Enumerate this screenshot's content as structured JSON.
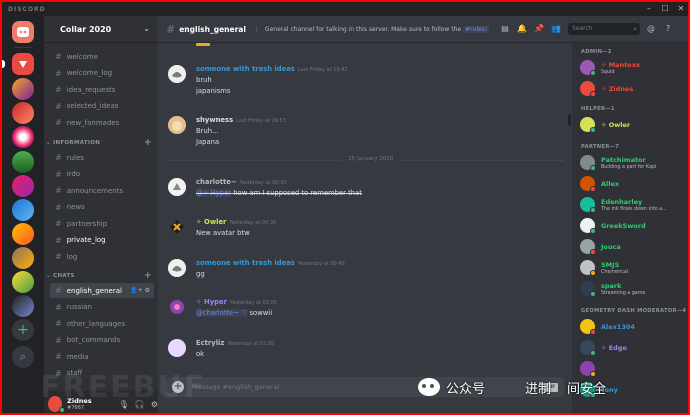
{
  "app": {
    "brand": "DISCORD",
    "window_controls": {
      "minimize": "–",
      "maximize": "☐",
      "close": "✕"
    }
  },
  "server": {
    "name": "Collar 2020"
  },
  "channels": {
    "top": [
      "welcome",
      "welcome_log",
      "idea_requests",
      "selected_ideas",
      "new_fanmades"
    ],
    "information_label": "INFORMATION",
    "information": [
      "rules",
      "irdo",
      "announcements",
      "news",
      "partnership",
      "private_log",
      "log"
    ],
    "chats_label": "CHATS",
    "chats": [
      "english_general",
      "russian",
      "other_languages",
      "bot_commands",
      "media",
      "staff"
    ]
  },
  "user": {
    "name": "Zidnes",
    "tag": "#7667"
  },
  "header": {
    "channel": "english_general",
    "topic": "General channel for talking in this server. Make sure to follow the",
    "topic_tag": "#rules!",
    "search_placeholder": "Search"
  },
  "messages": [
    {
      "author": "someone with trash ideas",
      "color": "#3498db",
      "time": "Last Friday at 19:42",
      "lines": [
        "bruh",
        "japanisms"
      ]
    },
    {
      "author": "shywness",
      "color": "#dcddde",
      "time": "Last Friday at 19:53",
      "lines": [
        "Bruh...",
        "Japana"
      ]
    },
    {
      "author": "charlotte~",
      "color": "#b9bbbe",
      "time": "Yesterday at 00:30",
      "mention": "@✧ Hyper",
      "text": "how am I supposed to remember that"
    },
    {
      "author": "✧ Owler",
      "color": "#d4e157",
      "time": "Yesterday at 00:30",
      "lines": [
        "New avatar btw"
      ]
    },
    {
      "author": "someone with trash ideas",
      "color": "#3498db",
      "time": "Yesterday at 00:49",
      "lines": [
        "gg"
      ]
    },
    {
      "author": "✧ Hyper",
      "color": "#9b84ee",
      "time": "Yesterday at 02:05",
      "mention": "@charlotte~ ♡",
      "text": "sowwii"
    },
    {
      "author": "Ectryliz",
      "color": "#b9bbbe",
      "time": "Yesterday at 02:05",
      "lines": [
        "ok"
      ]
    }
  ],
  "date_divider": "25 January 2020",
  "composer": {
    "placeholder": "Message #english_general",
    "gift": "GIF"
  },
  "members": {
    "groups": [
      {
        "label": "ADMIN—2",
        "items": [
          {
            "name": "✧ Mantexx",
            "sub": "Squid",
            "color": "#e74c3c"
          },
          {
            "name": "✧ Zidnes",
            "sub": "",
            "color": "#e74c3c"
          }
        ]
      },
      {
        "label": "HELPER—1",
        "items": [
          {
            "name": "✧ Owler",
            "sub": "",
            "color": "#d4e157"
          }
        ]
      },
      {
        "label": "PARTNER—7",
        "items": [
          {
            "name": "Patchimator",
            "sub": "Building a part for Kapi",
            "color": "#2ecc71"
          },
          {
            "name": "Allex",
            "sub": "",
            "color": "#2ecc71"
          },
          {
            "name": "Edenharley",
            "sub": "The ink flows down into a...",
            "color": "#2ecc71"
          },
          {
            "name": "GreekSword",
            "sub": "",
            "color": "#2ecc71"
          },
          {
            "name": "Jouca",
            "sub": "",
            "color": "#2ecc71"
          },
          {
            "name": "SMJS",
            "sub": "Chemerical",
            "color": "#2ecc71"
          },
          {
            "name": "spark",
            "sub": "Streaming a game",
            "color": "#2ecc71"
          }
        ]
      },
      {
        "label": "GEOMETRY DASH MODERATOR—4",
        "items": [
          {
            "name": "Alex1304",
            "sub": "",
            "color": "#3498db"
          },
          {
            "name": "✧ Edge",
            "sub": "",
            "color": "#9b84ee"
          },
          {
            "name": "",
            "sub": "",
            "color": "#3498db"
          },
          {
            "name": "Tony",
            "sub": "",
            "color": "#3498db"
          }
        ]
      }
    ]
  },
  "watermark": {
    "text1": "公众号",
    "text2": "进制",
    "text3": "间安全",
    "bg_text": "FREEBUF"
  }
}
